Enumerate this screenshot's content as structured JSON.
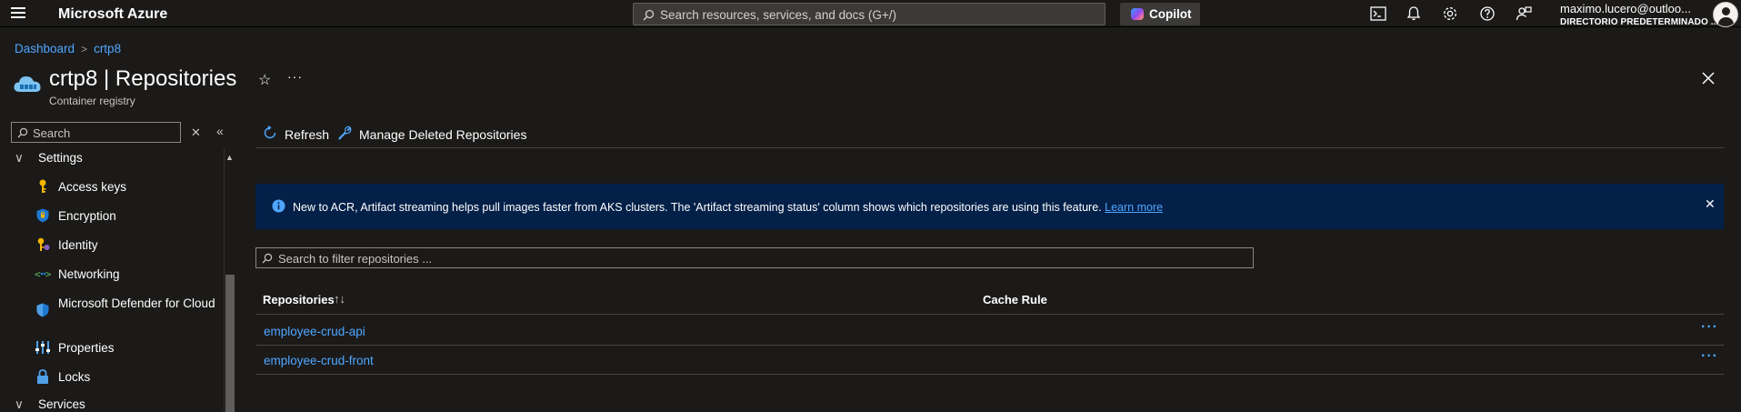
{
  "topbar": {
    "brand": "Microsoft Azure",
    "search_placeholder": "Search resources, services, and docs (G+/)",
    "copilot_label": "Copilot",
    "account_name": "maximo.lucero@outloo...",
    "account_directory": "DIRECTORIO PREDETERMINADO ..."
  },
  "breadcrumb": {
    "items": [
      "Dashboard",
      "crtp8"
    ]
  },
  "resource": {
    "title": "crtp8 | Repositories",
    "subtitle": "Container registry"
  },
  "sidebar": {
    "search_placeholder": "Search",
    "groups": [
      {
        "label": "Settings",
        "expanded": true
      },
      {
        "label": "Services",
        "expanded": true
      }
    ],
    "items": [
      {
        "label": "Access keys",
        "icon": "key-icon"
      },
      {
        "label": "Encryption",
        "icon": "shield-icon"
      },
      {
        "label": "Identity",
        "icon": "identity-key-icon"
      },
      {
        "label": "Networking",
        "icon": "networking-icon"
      },
      {
        "label": "Microsoft Defender for Cloud",
        "icon": "defender-shield-icon"
      },
      {
        "label": "Properties",
        "icon": "properties-icon"
      },
      {
        "label": "Locks",
        "icon": "lock-icon"
      }
    ]
  },
  "toolbar": {
    "refresh_label": "Refresh",
    "manage_deleted_label": "Manage Deleted Repositories"
  },
  "banner": {
    "message": "New to ACR, Artifact streaming helps pull images faster from AKS clusters. The 'Artifact streaming status' column shows which repositories are using this feature.",
    "link": "Learn more"
  },
  "filter": {
    "placeholder": "Search to filter repositories ..."
  },
  "table": {
    "columns": [
      "Repositories",
      "Cache Rule"
    ],
    "sort_indicator": "↑↓",
    "rows": [
      {
        "name": "employee-crud-api",
        "cache_rule": ""
      },
      {
        "name": "employee-crud-front",
        "cache_rule": ""
      }
    ]
  },
  "colors": {
    "link": "#4fa6ff",
    "banner_bg": "#032048",
    "page_bg": "#1b1a19"
  }
}
